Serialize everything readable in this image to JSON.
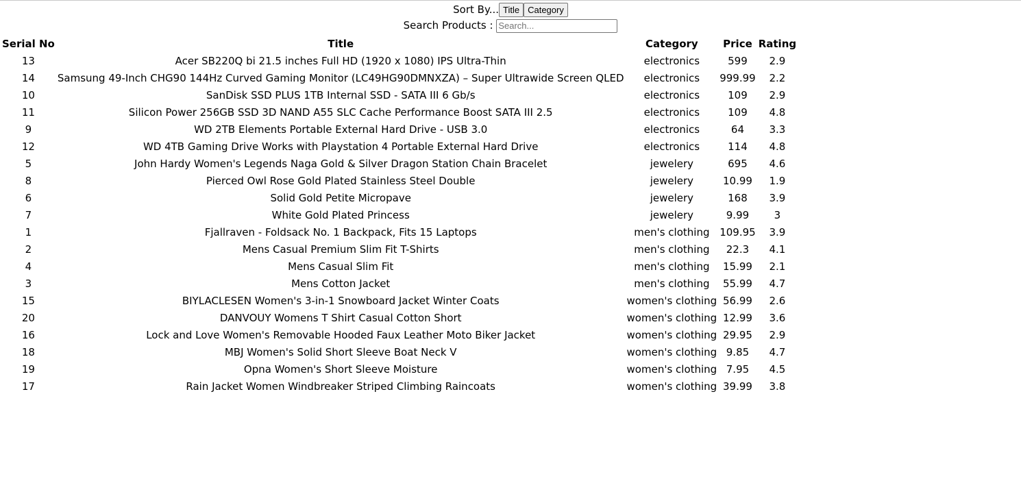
{
  "controls": {
    "sort_label": "Sort By...",
    "sort_title_button": "Title",
    "sort_category_button": "Category",
    "search_label": "Search Products : ",
    "search_placeholder": "Search...",
    "search_value": ""
  },
  "table": {
    "headers": [
      "Serial No",
      "Title",
      "Category",
      "Price",
      "Rating"
    ],
    "rows": [
      {
        "serial": "13",
        "title": "Acer SB220Q bi 21.5 inches Full HD (1920 x 1080) IPS Ultra-Thin",
        "category": "electronics",
        "price": "599",
        "rating": "2.9"
      },
      {
        "serial": "14",
        "title": "Samsung 49-Inch CHG90 144Hz Curved Gaming Monitor (LC49HG90DMNXZA) – Super Ultrawide Screen QLED",
        "category": "electronics",
        "price": "999.99",
        "rating": "2.2"
      },
      {
        "serial": "10",
        "title": "SanDisk SSD PLUS 1TB Internal SSD - SATA III 6 Gb/s",
        "category": "electronics",
        "price": "109",
        "rating": "2.9"
      },
      {
        "serial": "11",
        "title": "Silicon Power 256GB SSD 3D NAND A55 SLC Cache Performance Boost SATA III 2.5",
        "category": "electronics",
        "price": "109",
        "rating": "4.8"
      },
      {
        "serial": "9",
        "title": "WD 2TB Elements Portable External Hard Drive - USB 3.0",
        "category": "electronics",
        "price": "64",
        "rating": "3.3"
      },
      {
        "serial": "12",
        "title": "WD 4TB Gaming Drive Works with Playstation 4 Portable External Hard Drive",
        "category": "electronics",
        "price": "114",
        "rating": "4.8"
      },
      {
        "serial": "5",
        "title": "John Hardy Women's Legends Naga Gold & Silver Dragon Station Chain Bracelet",
        "category": "jewelery",
        "price": "695",
        "rating": "4.6"
      },
      {
        "serial": "8",
        "title": "Pierced Owl Rose Gold Plated Stainless Steel Double",
        "category": "jewelery",
        "price": "10.99",
        "rating": "1.9"
      },
      {
        "serial": "6",
        "title": "Solid Gold Petite Micropave",
        "category": "jewelery",
        "price": "168",
        "rating": "3.9"
      },
      {
        "serial": "7",
        "title": "White Gold Plated Princess",
        "category": "jewelery",
        "price": "9.99",
        "rating": "3"
      },
      {
        "serial": "1",
        "title": "Fjallraven - Foldsack No. 1 Backpack, Fits 15 Laptops",
        "category": "men's clothing",
        "price": "109.95",
        "rating": "3.9"
      },
      {
        "serial": "2",
        "title": "Mens Casual Premium Slim Fit T-Shirts",
        "category": "men's clothing",
        "price": "22.3",
        "rating": "4.1"
      },
      {
        "serial": "4",
        "title": "Mens Casual Slim Fit",
        "category": "men's clothing",
        "price": "15.99",
        "rating": "2.1"
      },
      {
        "serial": "3",
        "title": "Mens Cotton Jacket",
        "category": "men's clothing",
        "price": "55.99",
        "rating": "4.7"
      },
      {
        "serial": "15",
        "title": "BIYLACLESEN Women's 3-in-1 Snowboard Jacket Winter Coats",
        "category": "women's clothing",
        "price": "56.99",
        "rating": "2.6"
      },
      {
        "serial": "20",
        "title": "DANVOUY Womens T Shirt Casual Cotton Short",
        "category": "women's clothing",
        "price": "12.99",
        "rating": "3.6"
      },
      {
        "serial": "16",
        "title": "Lock and Love Women's Removable Hooded Faux Leather Moto Biker Jacket",
        "category": "women's clothing",
        "price": "29.95",
        "rating": "2.9"
      },
      {
        "serial": "18",
        "title": "MBJ Women's Solid Short Sleeve Boat Neck V",
        "category": "women's clothing",
        "price": "9.85",
        "rating": "4.7"
      },
      {
        "serial": "19",
        "title": "Opna Women's Short Sleeve Moisture",
        "category": "women's clothing",
        "price": "7.95",
        "rating": "4.5"
      },
      {
        "serial": "17",
        "title": "Rain Jacket Women Windbreaker Striped Climbing Raincoats",
        "category": "women's clothing",
        "price": "39.99",
        "rating": "3.8"
      }
    ]
  }
}
